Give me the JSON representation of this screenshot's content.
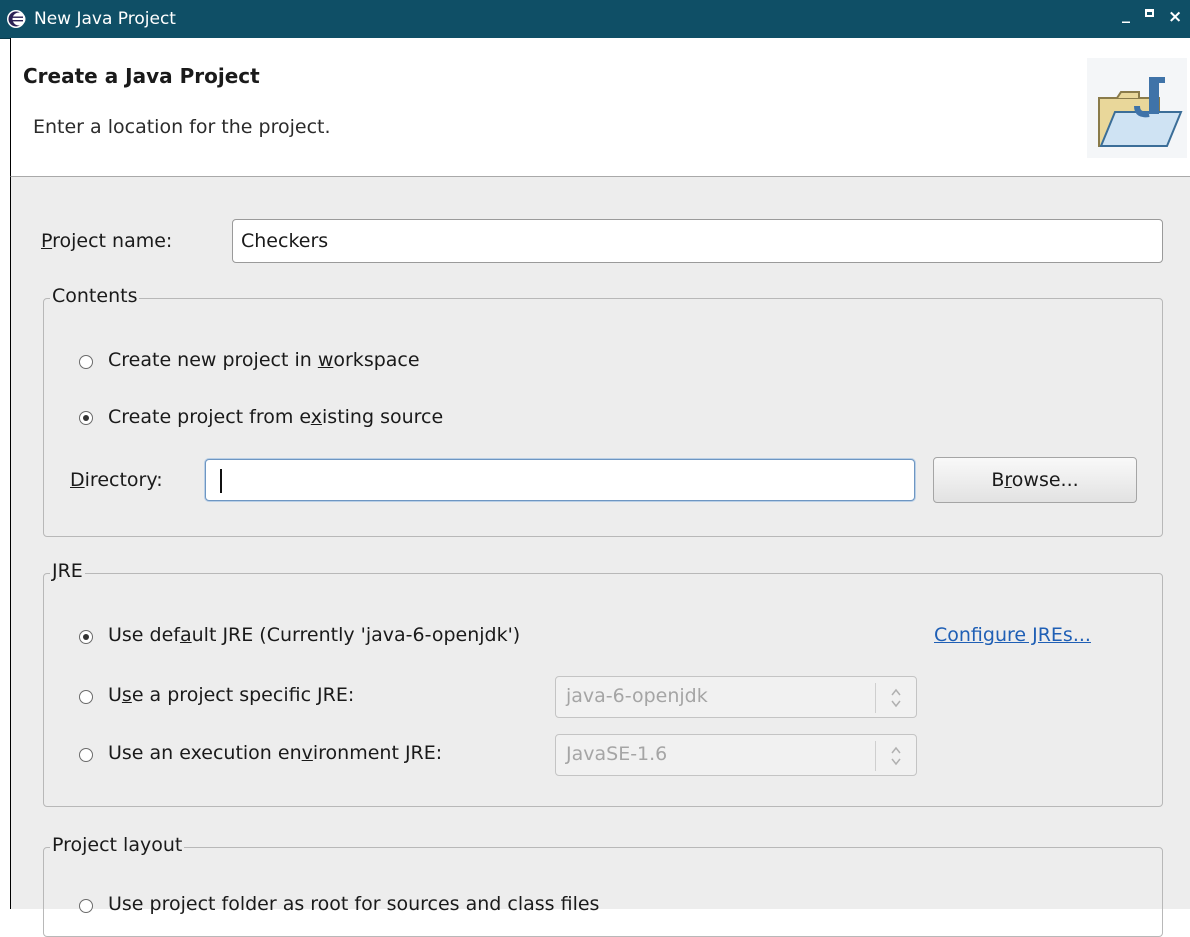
{
  "window": {
    "title": "New Java Project",
    "controls": {
      "minimize": "_",
      "maximize": "□",
      "close": "×"
    }
  },
  "header": {
    "title": "Create a Java Project",
    "message": "Enter a location for the project."
  },
  "project_name": {
    "label_pre": "",
    "label_mnemonic": "P",
    "label_post": "roject name:",
    "value": "Checkers"
  },
  "contents": {
    "legend": "Contents",
    "options": [
      {
        "pre": "Create new project in ",
        "mnemonic": "w",
        "post": "orkspace",
        "selected": false
      },
      {
        "pre": "Create project from e",
        "mnemonic": "x",
        "post": "isting source",
        "selected": true
      }
    ],
    "directory": {
      "label_mnemonic": "D",
      "label_post": "irectory:",
      "value": ""
    },
    "browse": {
      "pre": "B",
      "mnemonic": "r",
      "post": "owse..."
    }
  },
  "jre": {
    "legend_mnemonic": "J",
    "legend_post": "RE",
    "options": [
      {
        "pre": "Use def",
        "mnemonic": "a",
        "post": "ult JRE (Currently 'java-6-openjdk')",
        "selected": true
      },
      {
        "pre": "U",
        "mnemonic": "s",
        "post": "e a project specific JRE:",
        "selected": false
      },
      {
        "pre": "Use an execution en",
        "mnemonic": "v",
        "post": "ironment JRE:",
        "selected": false
      }
    ],
    "configure_link": "Configure JREs...",
    "specific_jre_select": "java-6-openjdk",
    "execution_env_select": "JavaSE-1.6"
  },
  "layout": {
    "legend": "Project layout",
    "partial_option": "Use project folder as root for sources and class files"
  },
  "colors": {
    "titlebar": "#0f4f66",
    "dialog_bg": "#ededed",
    "link": "#1f5fb5"
  }
}
